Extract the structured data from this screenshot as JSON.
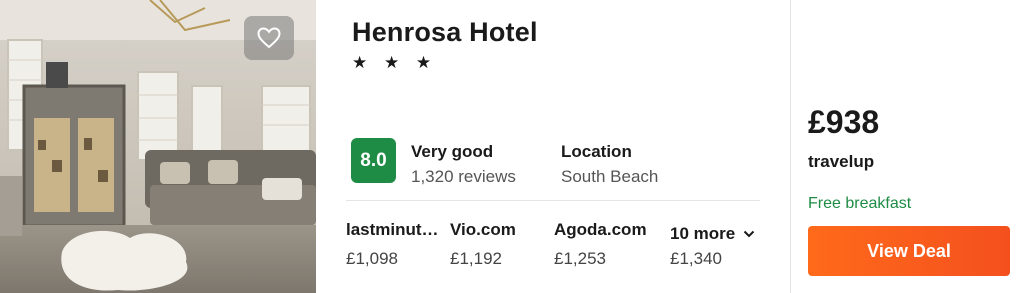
{
  "hotel": {
    "name": "Henrosa Hotel",
    "stars": "★ ★ ★",
    "image_alt_icon": "favorite-heart-icon"
  },
  "rating": {
    "score": "8.0",
    "label": "Very good",
    "reviews": "1,320 reviews",
    "badge_color": "#1f8c45"
  },
  "location": {
    "label": "Location",
    "value": "South Beach"
  },
  "providers": [
    {
      "name": "lastminut…",
      "price": "£1,098"
    },
    {
      "name": "Vio.com",
      "price": "£1,192"
    },
    {
      "name": "Agoda.com",
      "price": "£1,253"
    }
  ],
  "more_providers": {
    "label": "10 more",
    "price": "£1,340",
    "icon": "chevron-down-icon"
  },
  "deal": {
    "price": "£938",
    "provider": "travelup",
    "perk": "Free breakfast",
    "button_label": "View Deal",
    "button_color": "#f4501e",
    "perk_color": "#1f8c45"
  }
}
